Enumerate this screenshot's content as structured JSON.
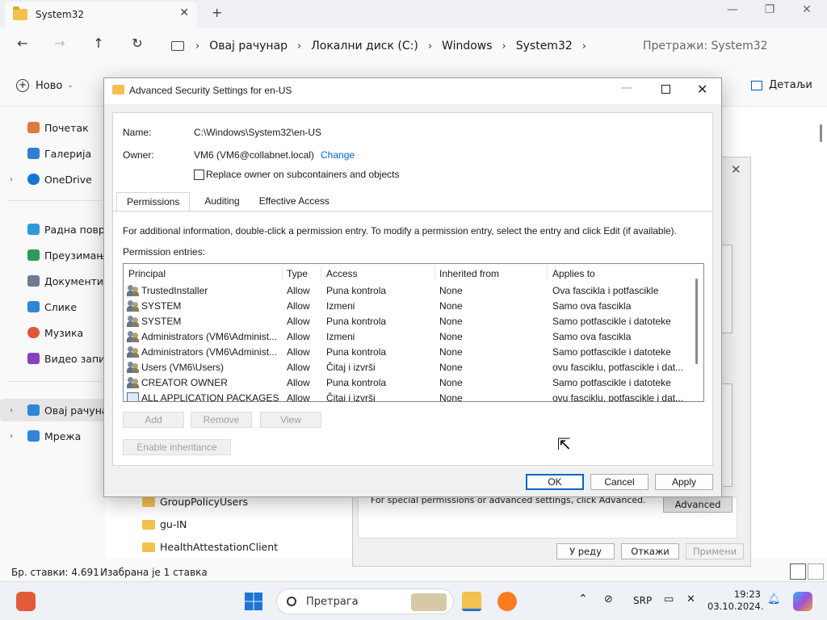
{
  "explorer": {
    "tab_title": "System32",
    "new_tab": "+",
    "window_controls": {
      "minimize": "—",
      "maximize": "❐",
      "close": "✕"
    },
    "nav": {
      "back": "←",
      "forward": "→",
      "up": "↑",
      "refresh": "↻"
    },
    "breadcrumb": [
      "Овај рачунар",
      "Локални диск (C:)",
      "Windows",
      "System32"
    ],
    "search_placeholder": "Претражи: System32",
    "new_label": "Ново",
    "details_label": "Детаљи",
    "sidebar": [
      {
        "label": "Почетак",
        "icon": "home-icon",
        "color": "#e07a3a"
      },
      {
        "label": "Галерија",
        "icon": "gallery-icon",
        "color": "#2f7fd1"
      },
      {
        "label": "OneDrive",
        "icon": "cloud-icon",
        "color": "#1476d6"
      },
      {
        "label": "Радна површ",
        "icon": "desktop-icon",
        "color": "#2f9bd6"
      },
      {
        "label": "Преузимања",
        "icon": "download-icon",
        "color": "#2c9b59"
      },
      {
        "label": "Документи",
        "icon": "documents-icon",
        "color": "#6d7b91"
      },
      {
        "label": "Слике",
        "icon": "pictures-icon",
        "color": "#2f86d6"
      },
      {
        "label": "Музика",
        "icon": "music-icon",
        "color": "#e0573a"
      },
      {
        "label": "Видео записи",
        "icon": "video-icon",
        "color": "#8a3fc0"
      },
      {
        "label": "Овај рачунар",
        "icon": "computer-icon",
        "color": "#2f86d6"
      },
      {
        "label": "Мрежа",
        "icon": "network-icon",
        "color": "#2f86d6"
      }
    ],
    "folders": [
      "GroupPolicyUsers",
      "gu-IN",
      "HealthAttestationClient"
    ],
    "status": {
      "items": "Бр. ставки: 4.691",
      "selected": "Изабрана је 1 ставка"
    }
  },
  "properties_dialog": {
    "note": "For special permissions or advanced settings, click Advanced.",
    "advanced": "Advanced",
    "ok": "У реду",
    "cancel": "Откажи",
    "apply": "Примени",
    "close": "✕"
  },
  "dialog": {
    "title": "Advanced Security Settings for en-US",
    "name_label": "Name:",
    "name_value": "C:\\Windows\\System32\\en-US",
    "owner_label": "Owner:",
    "owner_value": "VM6 (VM6@collabnet.local)",
    "owner_change": "Change",
    "replace_owner": "Replace owner on subcontainers and objects",
    "tabs": [
      "Permissions",
      "Auditing",
      "Effective Access"
    ],
    "info": "For additional information, double-click a permission entry. To modify a permission entry, select the entry and click Edit (if available).",
    "entries_label": "Permission entries:",
    "columns": [
      "Principal",
      "Type",
      "Access",
      "Inherited from",
      "Applies to"
    ],
    "rows": [
      {
        "principal": "TrustedInstaller",
        "type": "Allow",
        "access": "Puna kontrola",
        "inherited": "None",
        "applies": "Ova fascikla i potfascikle",
        "icon": "users"
      },
      {
        "principal": "SYSTEM",
        "type": "Allow",
        "access": "Izmeni",
        "inherited": "None",
        "applies": "Samo ova fascikla",
        "icon": "users"
      },
      {
        "principal": "SYSTEM",
        "type": "Allow",
        "access": "Puna kontrola",
        "inherited": "None",
        "applies": "Samo potfascikle i datoteke",
        "icon": "users"
      },
      {
        "principal": "Administrators (VM6\\Administ...",
        "type": "Allow",
        "access": "Izmeni",
        "inherited": "None",
        "applies": "Samo ova fascikla",
        "icon": "users"
      },
      {
        "principal": "Administrators (VM6\\Administ...",
        "type": "Allow",
        "access": "Puna kontrola",
        "inherited": "None",
        "applies": "Samo potfascikle i datoteke",
        "icon": "users"
      },
      {
        "principal": "Users (VM6\\Users)",
        "type": "Allow",
        "access": "Čitaj i izvrši",
        "inherited": "None",
        "applies": "ovu fasciklu, potfascikle i dat...",
        "icon": "users"
      },
      {
        "principal": "CREATOR OWNER",
        "type": "Allow",
        "access": "Puna kontrola",
        "inherited": "None",
        "applies": "Samo potfascikle i datoteke",
        "icon": "users"
      },
      {
        "principal": "ALL APPLICATION PACKAGES",
        "type": "Allow",
        "access": "Čitaj i izvrši",
        "inherited": "None",
        "applies": "ovu fasciklu, potfascikle i dat...",
        "icon": "package"
      }
    ],
    "add": "Add",
    "remove": "Remove",
    "view": "View",
    "enable_inheritance": "Enable inheritance",
    "ok": "OK",
    "cancel": "Cancel",
    "apply": "Apply"
  },
  "taskbar": {
    "search_placeholder": "Претрага",
    "language": "SRP",
    "time": "19:23",
    "date": "03.10.2024."
  }
}
